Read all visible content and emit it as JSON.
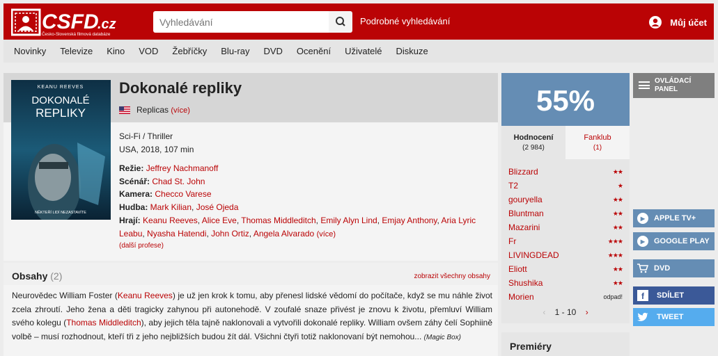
{
  "header": {
    "logo_text": "CSFD.cz",
    "logo_tagline": "Česko-Slovenská filmová databáze",
    "search_placeholder": "Vyhledávání",
    "advanced_search": "Podrobné vyhledávání",
    "account": "Můj účet"
  },
  "nav": [
    "Novinky",
    "Televize",
    "Kino",
    "VOD",
    "Žebříčky",
    "Blu-ray",
    "DVD",
    "Ocenění",
    "Uživatelé",
    "Diskuze"
  ],
  "movie": {
    "title": "Dokonalé repliky",
    "original_title": "Replicas",
    "original_more": "(více)",
    "genre": "Sci-Fi / Thriller",
    "origin": "USA, 2018, 107 min",
    "poster": {
      "actor": "KEANU REEVES",
      "title_line1": "DOKONALÉ",
      "title_line2": "REPLIKY",
      "tagline": "NĚKTEŘÍ LIDÍ NEZASTAVÍTE"
    },
    "director_label": "Režie:",
    "director": "Jeffrey Nachmanoff",
    "writer_label": "Scénář:",
    "writer": "Chad St. John",
    "camera_label": "Kamera:",
    "camera": "Checco Varese",
    "music_label": "Hudba:",
    "music1": "Mark Kilian",
    "music2": "José Ojeda",
    "cast_label": "Hrají:",
    "cast": [
      "Keanu Reeves",
      "Alice Eve",
      "Thomas Middleditch",
      "Emily Alyn Lind",
      "Emjay Anthony",
      "Aria Lyric Leabu",
      "Nyasha Hatendi",
      "John Ortiz",
      "Angela Alvarado"
    ],
    "cast_more": "(více)",
    "other_professions": "(další profese)"
  },
  "synopsis": {
    "title": "Obsahy",
    "count": "(2)",
    "show_all": "zobrazit všechny obsahy",
    "text_1": "Neurovědec William Foster (",
    "link_1": "Keanu Reeves",
    "text_2": ") je už jen krok k tomu, aby přenesl lidské vědomí do počítače, když se mu náhle život zcela zhroutí. Jeho žena a děti tragicky zahynou při autonehodě. V zoufalé snaze přivést je znovu k životu, přemluví William svého kolegu (",
    "link_2": "Thomas Middleditch",
    "text_3": "), aby jejich těla tajně naklonovali a vytvořili dokonalé repliky. William ovšem záhy čelí Sophiině volbě – musí rozhodnout, kteří tři z jeho nejbližších budou žít dál. Všichni čtyři totiž naklonovaní být nemohou...",
    "source": "(Magic Box)"
  },
  "rating": {
    "score": "55%",
    "tab_ratings_label": "Hodnocení",
    "tab_ratings_count": "(2 984)",
    "tab_fanclub_label": "Fanklub",
    "tab_fanclub_count": "(1)",
    "users": [
      {
        "name": "Blizzard",
        "stars": 2,
        "text": ""
      },
      {
        "name": "T2",
        "stars": 1,
        "text": ""
      },
      {
        "name": "gouryella",
        "stars": 2,
        "text": ""
      },
      {
        "name": "Bluntman",
        "stars": 2,
        "text": ""
      },
      {
        "name": "Mazarini",
        "stars": 2,
        "text": ""
      },
      {
        "name": "Fr",
        "stars": 3,
        "text": ""
      },
      {
        "name": "LIVINGDEAD",
        "stars": 3,
        "text": ""
      },
      {
        "name": "Eliott",
        "stars": 2,
        "text": ""
      },
      {
        "name": "Shushika",
        "stars": 2,
        "text": ""
      },
      {
        "name": "Morien",
        "stars": 0,
        "text": "odpad!"
      }
    ],
    "pager": "1 - 10"
  },
  "premiery_label": "Premiéry",
  "sidebar": {
    "control_panel_line1": "OVLÁDACÍ",
    "control_panel_line2": "PANEL",
    "apple": "APPLE TV+",
    "google": "GOOGLE PLAY",
    "dvd": "DVD",
    "share": "SDÍLET",
    "tweet": "TWEET"
  },
  "colors": {
    "brand_red": "#ba0305",
    "score_blue": "#658db4",
    "facebook": "#3b5998",
    "twitter": "#55acee"
  }
}
